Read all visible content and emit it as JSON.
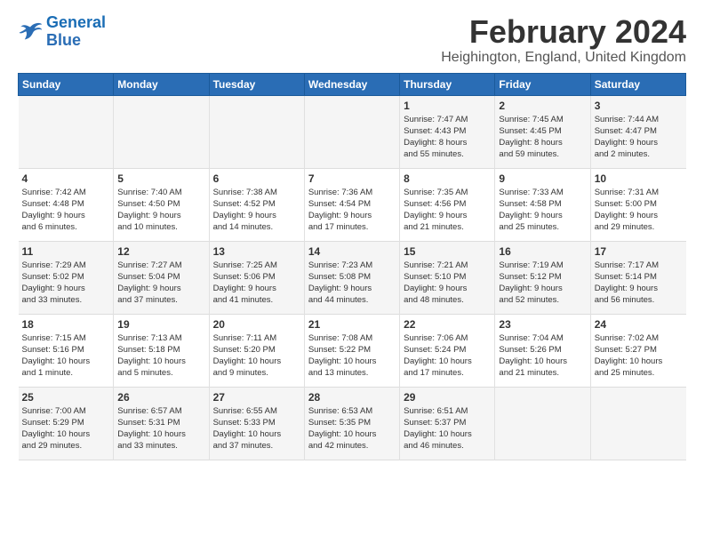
{
  "header": {
    "logo_general": "General",
    "logo_blue": "Blue",
    "month_title": "February 2024",
    "location": "Heighington, England, United Kingdom"
  },
  "weekdays": [
    "Sunday",
    "Monday",
    "Tuesday",
    "Wednesday",
    "Thursday",
    "Friday",
    "Saturday"
  ],
  "weeks": [
    [
      {
        "day": "",
        "info": ""
      },
      {
        "day": "",
        "info": ""
      },
      {
        "day": "",
        "info": ""
      },
      {
        "day": "",
        "info": ""
      },
      {
        "day": "1",
        "info": "Sunrise: 7:47 AM\nSunset: 4:43 PM\nDaylight: 8 hours\nand 55 minutes."
      },
      {
        "day": "2",
        "info": "Sunrise: 7:45 AM\nSunset: 4:45 PM\nDaylight: 8 hours\nand 59 minutes."
      },
      {
        "day": "3",
        "info": "Sunrise: 7:44 AM\nSunset: 4:47 PM\nDaylight: 9 hours\nand 2 minutes."
      }
    ],
    [
      {
        "day": "4",
        "info": "Sunrise: 7:42 AM\nSunset: 4:48 PM\nDaylight: 9 hours\nand 6 minutes."
      },
      {
        "day": "5",
        "info": "Sunrise: 7:40 AM\nSunset: 4:50 PM\nDaylight: 9 hours\nand 10 minutes."
      },
      {
        "day": "6",
        "info": "Sunrise: 7:38 AM\nSunset: 4:52 PM\nDaylight: 9 hours\nand 14 minutes."
      },
      {
        "day": "7",
        "info": "Sunrise: 7:36 AM\nSunset: 4:54 PM\nDaylight: 9 hours\nand 17 minutes."
      },
      {
        "day": "8",
        "info": "Sunrise: 7:35 AM\nSunset: 4:56 PM\nDaylight: 9 hours\nand 21 minutes."
      },
      {
        "day": "9",
        "info": "Sunrise: 7:33 AM\nSunset: 4:58 PM\nDaylight: 9 hours\nand 25 minutes."
      },
      {
        "day": "10",
        "info": "Sunrise: 7:31 AM\nSunset: 5:00 PM\nDaylight: 9 hours\nand 29 minutes."
      }
    ],
    [
      {
        "day": "11",
        "info": "Sunrise: 7:29 AM\nSunset: 5:02 PM\nDaylight: 9 hours\nand 33 minutes."
      },
      {
        "day": "12",
        "info": "Sunrise: 7:27 AM\nSunset: 5:04 PM\nDaylight: 9 hours\nand 37 minutes."
      },
      {
        "day": "13",
        "info": "Sunrise: 7:25 AM\nSunset: 5:06 PM\nDaylight: 9 hours\nand 41 minutes."
      },
      {
        "day": "14",
        "info": "Sunrise: 7:23 AM\nSunset: 5:08 PM\nDaylight: 9 hours\nand 44 minutes."
      },
      {
        "day": "15",
        "info": "Sunrise: 7:21 AM\nSunset: 5:10 PM\nDaylight: 9 hours\nand 48 minutes."
      },
      {
        "day": "16",
        "info": "Sunrise: 7:19 AM\nSunset: 5:12 PM\nDaylight: 9 hours\nand 52 minutes."
      },
      {
        "day": "17",
        "info": "Sunrise: 7:17 AM\nSunset: 5:14 PM\nDaylight: 9 hours\nand 56 minutes."
      }
    ],
    [
      {
        "day": "18",
        "info": "Sunrise: 7:15 AM\nSunset: 5:16 PM\nDaylight: 10 hours\nand 1 minute."
      },
      {
        "day": "19",
        "info": "Sunrise: 7:13 AM\nSunset: 5:18 PM\nDaylight: 10 hours\nand 5 minutes."
      },
      {
        "day": "20",
        "info": "Sunrise: 7:11 AM\nSunset: 5:20 PM\nDaylight: 10 hours\nand 9 minutes."
      },
      {
        "day": "21",
        "info": "Sunrise: 7:08 AM\nSunset: 5:22 PM\nDaylight: 10 hours\nand 13 minutes."
      },
      {
        "day": "22",
        "info": "Sunrise: 7:06 AM\nSunset: 5:24 PM\nDaylight: 10 hours\nand 17 minutes."
      },
      {
        "day": "23",
        "info": "Sunrise: 7:04 AM\nSunset: 5:26 PM\nDaylight: 10 hours\nand 21 minutes."
      },
      {
        "day": "24",
        "info": "Sunrise: 7:02 AM\nSunset: 5:27 PM\nDaylight: 10 hours\nand 25 minutes."
      }
    ],
    [
      {
        "day": "25",
        "info": "Sunrise: 7:00 AM\nSunset: 5:29 PM\nDaylight: 10 hours\nand 29 minutes."
      },
      {
        "day": "26",
        "info": "Sunrise: 6:57 AM\nSunset: 5:31 PM\nDaylight: 10 hours\nand 33 minutes."
      },
      {
        "day": "27",
        "info": "Sunrise: 6:55 AM\nSunset: 5:33 PM\nDaylight: 10 hours\nand 37 minutes."
      },
      {
        "day": "28",
        "info": "Sunrise: 6:53 AM\nSunset: 5:35 PM\nDaylight: 10 hours\nand 42 minutes."
      },
      {
        "day": "29",
        "info": "Sunrise: 6:51 AM\nSunset: 5:37 PM\nDaylight: 10 hours\nand 46 minutes."
      },
      {
        "day": "",
        "info": ""
      },
      {
        "day": "",
        "info": ""
      }
    ]
  ]
}
